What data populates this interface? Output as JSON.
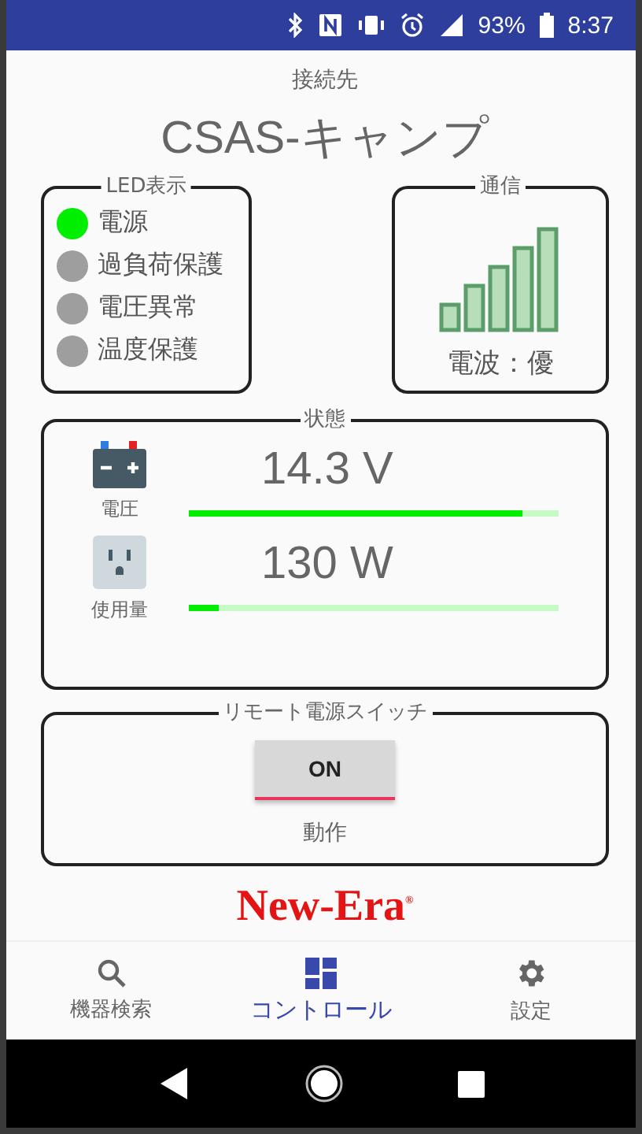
{
  "status_bar": {
    "battery": "93%",
    "time": "8:37"
  },
  "connection": {
    "label": "接続先",
    "name": "CSAS-キャンプ"
  },
  "led_panel": {
    "title": "LED表示",
    "leds": [
      {
        "label": "電源",
        "on": true
      },
      {
        "label": "過負荷保護",
        "on": false
      },
      {
        "label": "電圧異常",
        "on": false
      },
      {
        "label": "温度保護",
        "on": false
      }
    ]
  },
  "signal_panel": {
    "title": "通信",
    "reading": "電波：優"
  },
  "status_panel": {
    "title": "状態",
    "meters": [
      {
        "kind": "battery",
        "label": "電圧",
        "reading": "14.3 V",
        "level": 0.9
      },
      {
        "kind": "outlet",
        "label": "使用量",
        "reading": "130 W",
        "level": 0.08
      }
    ]
  },
  "switch_panel": {
    "title": "リモート電源スイッチ",
    "button": "ON",
    "caption": "動作"
  },
  "logo": "New-Era",
  "logo_mark": "®",
  "bottom_nav": [
    {
      "kind": "search",
      "label": "機器検索",
      "selected": false
    },
    {
      "kind": "grid",
      "label": "コントロール",
      "selected": true
    },
    {
      "kind": "gear",
      "label": "設定",
      "selected": false
    }
  ]
}
